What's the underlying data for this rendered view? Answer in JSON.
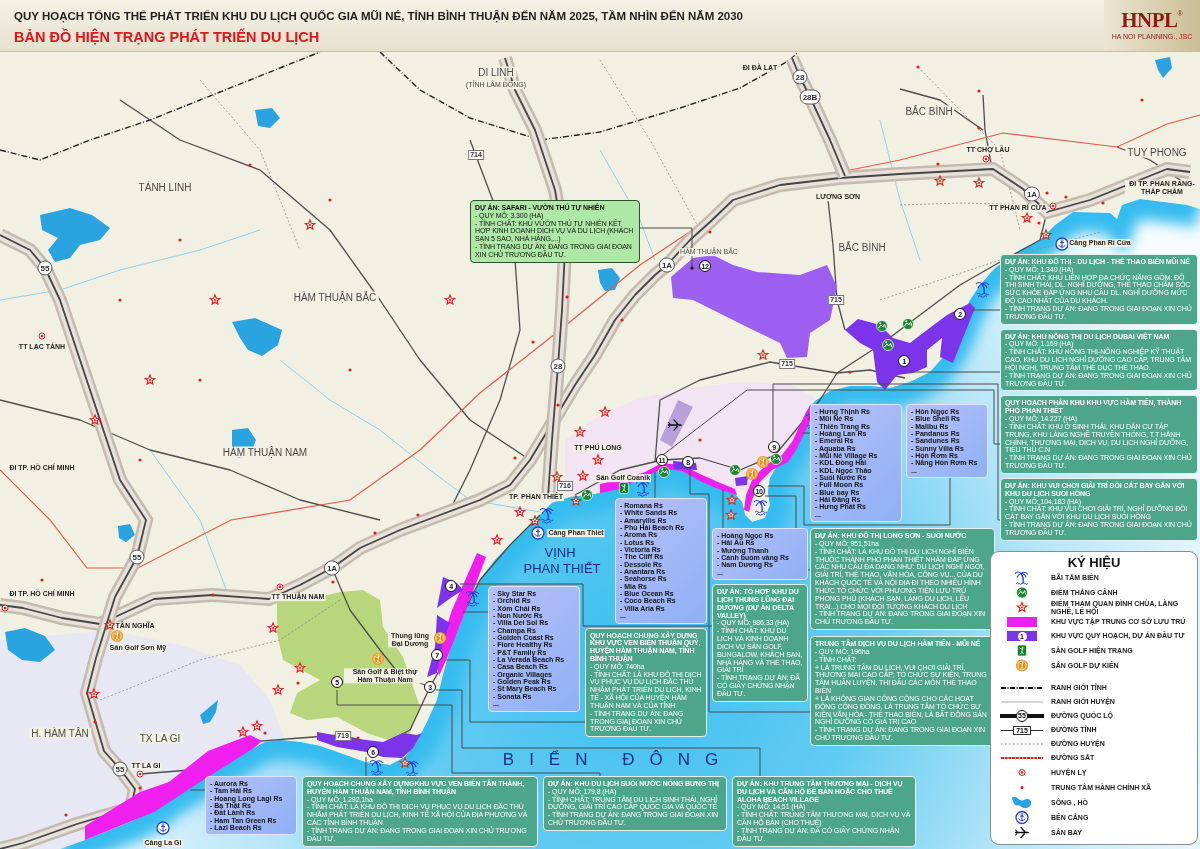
{
  "header": {
    "title": "QUY HOẠCH TỔNG THỂ PHÁT TRIỂN KHU DU LỊCH QUỐC GIA MŨI NÉ, TỈNH BÌNH THUẬN ĐẾN NĂM 2025, TẦM NHÌN ĐẾN NĂM 2030",
    "subtitle": "BẢN ĐỒ HIỆN TRẠNG PHÁT TRIỂN DU LỊCH",
    "logo": {
      "text": "HNPL",
      "mark": "®",
      "tagline": "HA NOI PLANNING., JSC"
    }
  },
  "places": [
    {
      "name": "DI LINH",
      "kind": "region"
    },
    {
      "name": "(TỈNH LÂM ĐỒNG)",
      "kind": "note"
    },
    {
      "name": "ĐI ĐÀ LẠT",
      "kind": "town"
    },
    {
      "name": "BẮC BÌNH",
      "kind": "region"
    },
    {
      "name": "TÁNH LINH",
      "kind": "region"
    },
    {
      "name": "TUY PHONG",
      "kind": "region"
    },
    {
      "name": "TT CHỢ LẦU",
      "kind": "town"
    },
    {
      "name": "LƯƠNG SƠN",
      "kind": "town"
    },
    {
      "name": "TT PHAN RÍ CỬA",
      "kind": "town"
    },
    {
      "name": "ĐI TP. PHAN RANG-THÁP CHÀM",
      "kind": "town"
    },
    {
      "name": "Cảng Phan Rí Cửa",
      "kind": "town"
    },
    {
      "name": "HÀM THUẬN BẮC",
      "kind": "region"
    },
    {
      "name": "HÀM THUẬN BẮC",
      "kind": "area"
    },
    {
      "name": "BẮC BÌNH",
      "kind": "region"
    },
    {
      "name": "TT LẠC TÁNH",
      "kind": "town"
    },
    {
      "name": "HÀM THUẬN NAM",
      "kind": "region"
    },
    {
      "name": "ĐI TP. HỒ CHÍ MINH",
      "kind": "town"
    },
    {
      "name": "TT PHÚ LONG",
      "kind": "town"
    },
    {
      "name": "TP. PHAN THIẾT",
      "kind": "town"
    },
    {
      "name": "Sân Golf Coanik",
      "kind": "town"
    },
    {
      "name": "Cảng Phan Thiết",
      "kind": "town"
    },
    {
      "name": "VỊNH",
      "kind": "sea"
    },
    {
      "name": "PHAN THIẾT",
      "kind": "sea"
    },
    {
      "name": "ĐI TP. HỒ CHÍ MINH",
      "kind": "town"
    },
    {
      "name": "TÂN NGHĨA",
      "kind": "town"
    },
    {
      "name": "Sân Golf Sơn Mỹ",
      "kind": "town"
    },
    {
      "name": "TT THUẬN NAM",
      "kind": "town"
    },
    {
      "name": "Thung lũng Đại Dương",
      "kind": "site"
    },
    {
      "name": "Sân Golf & Biệt thự Hàm Thuận Nam",
      "kind": "site"
    },
    {
      "name": "H. HÀM TÂN",
      "kind": "region"
    },
    {
      "name": "TX LA GI",
      "kind": "region"
    },
    {
      "name": "TT LA GI",
      "kind": "town"
    },
    {
      "name": "BIỂN ĐÔNG",
      "kind": "ocean"
    },
    {
      "name": "Cảng La Gi",
      "kind": "town"
    }
  ],
  "road_markers": [
    {
      "number": "1A",
      "kind": "national"
    },
    {
      "number": "1A",
      "kind": "national"
    },
    {
      "number": "1A",
      "kind": "national"
    },
    {
      "number": "55",
      "kind": "national"
    },
    {
      "number": "55",
      "kind": "national"
    },
    {
      "number": "55",
      "kind": "national"
    },
    {
      "number": "28",
      "kind": "national"
    },
    {
      "number": "28",
      "kind": "national"
    },
    {
      "number": "28B",
      "kind": "national"
    },
    {
      "number": "715",
      "kind": "provincial"
    },
    {
      "number": "715",
      "kind": "provincial"
    },
    {
      "number": "716",
      "kind": "provincial"
    },
    {
      "number": "719",
      "kind": "provincial"
    },
    {
      "number": "714",
      "kind": "provincial"
    }
  ],
  "zone_numbers": [
    "1",
    "2",
    "3",
    "4",
    "5",
    "6",
    "7",
    "8",
    "9",
    "10",
    "11",
    "12"
  ],
  "projects": [
    {
      "kind": "highlight",
      "title": "DỰ ÁN: SAFARI - VƯỜN THÚ TỰ NHIÊN",
      "lines": [
        "- QUY MÔ: 3.300 (HA)",
        "- TÍNH CHẤT: KHU VƯỜN THÚ TỰ NHIÊN KẾT HỢP KINH DOANH DỊCH VỤ VÀ DU LỊCH (KHÁCH SẠN 5 SAO, NHÀ HÀNG,...)",
        "- TÌNH TRẠNG DỰ ÁN: ĐANG TRONG GIAI ĐOẠN XIN CHỦ TRƯƠNG ĐẦU TƯ."
      ]
    },
    {
      "kind": "standard",
      "title": "DỰ ÁN: KHU ĐÔ THỊ - DU LỊCH - THỂ THAO BIỂN MŨI NÉ",
      "lines": [
        "- QUY MÔ: 1.340 (HA)",
        "- TÍNH CHẤT: KHU LIÊN HỢP ĐA CHỨC NĂNG GỒM: ĐÔ THỊ SINH THÁI, DL. NGHỈ DƯỠNG, THỂ THAO CHĂM SÓC SỨC KHỎE ĐÁP ỨNG NHU CẦU DL. NGHỈ DƯỠNG MỨC ĐỘ CAO NHẤT CỦA DU KHÁCH.",
        "- TÌNH TRẠNG DỰ ÁN: ĐANG TRONG GIAI ĐOẠN XIN CHỦ TRƯƠNG ĐẦU TƯ."
      ]
    },
    {
      "kind": "standard",
      "title": "DỰ ÁN: KHU NÔNG THỊ DU LỊCH DUBAI VIỆT NAM",
      "lines": [
        "- QUY MÔ: 1.169 (HA)",
        "- TÍNH CHẤT: KHU NÔNG THỊ-NÔNG NGHIỆP KỸ THUẬT CAO, KHU DU LỊCH NGHỈ DƯỠNG CAO CẤP, TRUNG TÂM HỘI NGHỊ, TRUNG TÂM THỂ DỤC THỂ THAO.",
        "- TÌNH TRẠNG DỰ ÁN: ĐANG TRONG GIAI ĐOẠN XIN CHỦ TRƯƠNG ĐẦU TƯ."
      ]
    },
    {
      "kind": "standard",
      "title": "QUY HOẠCH PHÂN KHU KHU VỰC HÀM TIẾN, THÀNH PHỐ PHAN THIẾT",
      "lines": [
        "- QUY MÔ: 14.227 (HA)",
        "- TÍNH CHẤT: KHU Ở SINH THÁI, KHU DÂN CƯ TẬP TRUNG, KHU LÀNG NGHỀ TRUYỀN THỐNG, T.T HÀNH CHÍNH, THƯƠNG MẠI, DỊCH VỤ, DU LỊCH NGHỈ DƯỠNG, TIỂU THỦ C.N",
        "- TÌNH TRẠNG DỰ ÁN: ĐANG TRONG GIAI ĐOẠN XIN CHỦ TRƯƠNG ĐẦU TƯ."
      ]
    },
    {
      "kind": "standard",
      "title": "DỰ ÁN: KHU VUI CHƠI GIẢI TRÍ ĐỒI CÁT BAY GẮN VỚI KHU DU LỊCH SUỐI HỒNG",
      "lines": [
        "- QUY MÔ: 104,183 (HA)",
        "- TÍNH CHẤT: KHU VUI CHƠI GIẢI TRÍ, NGHỈ DƯỠNG ĐỒI CÁT BAY GẮN VỚI KHU DU LỊCH SUỐI HỒNG",
        "- TÌNH TRẠNG DỰ ÁN: ĐANG TRONG GIAI ĐOẠN XIN CHỦ TRƯƠNG ĐẦU TƯ."
      ]
    },
    {
      "kind": "standard",
      "title": "DỰ ÁN: KHU ĐÔ THỊ LONG SƠN - SUỐI NƯỚC",
      "lines": [
        "- QUY MÔ: 951,51ha",
        "- TÍNH CHẤT: LÀ KHU ĐÔ THỊ DU LỊCH NGHỈ BIỂN THUỘC THÀNH PHỐ PHAN THIẾT NHẰM ĐÁP ỨNG CÁC NHU CẦU ĐA DẠNG NHƯ: DU LỊCH NGHỈ NGƠI, GIẢI TRÍ, THỂ THAO, VĂN HÓA, CÔNG VỤ... CỦA DU KHÁCH QUỐC TẾ VÀ NỘI ĐỊA ĐI THEO NHIỀU HÌNH THỨC TỔ CHỨC VỚI PHƯƠNG TIỆN LƯU TRÚ PHONG PHÚ (KHÁCH SẠN, LÀNG DU LỊCH, LỀU TRẠI...) CHO MỌI ĐỐI TƯỢNG KHÁCH DU LỊCH",
        "- TÌNH TRẠNG DỰ ÁN: ĐANG TRONG GIAI ĐOẠN XIN CHỦ TRƯƠNG ĐẦU TƯ."
      ]
    },
    {
      "kind": "standard",
      "title": "DỰ ÁN: TỔ HỢP KHU DU LỊCH THUNG LŨNG ĐẠI DƯƠNG (DỰ ÁN DELTA VALLEY)",
      "lines": [
        "- QUY MÔ: 986,33 (HA)",
        "- TÍNH CHẤT: KHU DU LỊCH VÀ KINH DOANH DỊCH VỤ SÂN GOLF, BUNGALOW, KHÁCH SẠN, NHÀ HÀNG VÀ THỂ THAO, GIẢI TRÍ",
        "- TÌNH TRẠNG DỰ ÁN: ĐÃ CÓ GIẤY CHỨNG NHẬN ĐẦU TƯ."
      ]
    },
    {
      "kind": "standard",
      "title": "QUY HOẠCH CHUNG XÂY DỰNG KHU VỰC VEN BIỂN THUẬN QUÝ, HUYỆN HÀM THUẬN NAM, TỈNH BÌNH THUẬN",
      "lines": [
        "- QUY MÔ: 740ha",
        "- TÍNH CHẤT: LÀ KHU ĐÔ THỊ DỊCH VỤ PHỤC VỤ DU LỊCH ĐẶC THÙ NHẰM PHÁT TRIỂN DU LỊCH, KINH TẾ - XÃ HỘI CỦA HUYỆN HÀM THUẬN NAM VÀ CỦA TỈNH",
        "- TÌNH TRẠNG DỰ ÁN: ĐANG TRONG GIAI ĐOẠN XIN CHỦ TRƯƠNG ĐẦU TƯ."
      ]
    },
    {
      "kind": "standard",
      "title": "TRUNG TÂM DỊCH VỤ DU LỊCH HÀM TIẾN - MŨI NÉ",
      "lines": [
        "- QUY MÔ: 196ha",
        "- TÍNH CHẤT:",
        "+ LÀ TRUNG TÂM DU LỊCH, VUI CHƠI GIẢI TRÍ, THƯƠNG MẠI CAO CẤP; TỔ CHỨC SỰ KIỆN, TRUNG TÂM HUẤN LUYỆN, THI ĐẤU CÁC MÔN THỂ THAO BIỂN",
        "+ LÀ KHÔNG GIAN CÔNG CỘNG CHO CÁC HOẠT ĐỘNG CỘNG ĐỒNG, LÀ TRUNG TÂM TỔ CHỨC SỰ KIỆN VĂN HÓA - THỂ THAO BIỂN, LÀ BẤT ĐỘNG SẢN NGHỈ DƯỠNG CÓ GIÁ TRỊ CAO",
        "- TÌNH TRẠNG DỰ ÁN: ĐANG TRONG GIAI ĐOẠN XIN CHỦ TRƯƠNG ĐẦU TƯ."
      ]
    },
    {
      "kind": "standard",
      "title": "QUY HOẠCH CHUNG XÂY DỰNGKHU VỰC VEN BIỂN TÂN THÀNH, HUYỆN HÀM THUẬN NAM, TỈNH BÌNH THUẬN",
      "lines": [
        "- QUY MÔ: 1.292,1ha",
        "- TÍNH CHẤT: LÀ KHU ĐÔ THỊ DỊCH VỤ PHỤC VỤ DU LỊCH ĐẶC THÙ NHẰM PHÁT TRIỂN DU LỊCH, KINH TẾ XÃ HỘI CỦA ĐỊA PHƯƠNG VÀ CÁC TỈNH BÌNH THUẬN",
        "- TÌNH TRẠNG DỰ ÁN: ĐANG TRONG GIAI ĐOẠN XIN CHỦ TRƯƠNG ĐẦU TƯ."
      ]
    },
    {
      "kind": "standard",
      "title": "DỰ ÁN: KHU DU LỊCH SUỐI NƯỚC NÓNG BƯNG THỊ",
      "lines": [
        "- QUY MÔ: 179,8 (HA)",
        "- TÍNH CHẤT: TRUNG TÂM DU LỊCH SINH THÁI, NGHỈ DƯỠNG, GIẢI TRÍ CAO CẤP QUỐC GIA VÀ QUỐC TẾ",
        "- TÌNH TRẠNG DỰ ÁN: ĐANG TRONG GIAI ĐOẠN XIN CHỦ TRƯƠNG ĐẦU TƯ."
      ]
    },
    {
      "kind": "standard",
      "title": "DỰ ÁN: KHU TRUNG TÂM THƯƠNG MẠI - DỊCH VỤ DU LỊCH VÀ CĂN HỘ ĐỂ BÁN HOẶC CHO THUÊ ALOHA BEACH VILLAGE",
      "lines": [
        "- QUY MÔ: 14,51 (HA)",
        "- TÍNH CHẤT: TRUNG TÂM THƯƠNG MẠI, DỊCH VỤ VÀ CĂN HỘ BÁN (CHO THUÊ)",
        "- TÌNH TRẠNG DỰ ÁN: ĐÃ CÓ GIẤY CHỨNG NHẬN ĐẦU TƯ."
      ]
    }
  ],
  "resort_lists": [
    {
      "items": [
        "- Hưng Thịnh Rs",
        "- Mũi Né Rs",
        "- Thiên Trang Rs",
        "- Hoàng Lan Rs",
        "- Emeral Rs",
        "- Aquaba Rs",
        "- Mũi Né Village Rs",
        "- KDL Đồng Hải",
        "- KDL Ngọc Thảo",
        "- Suối Nước Rs",
        "- Full Moon Rs",
        "- Blue bay Rs",
        "- Hải Đăng Rs",
        "- Hưng Phát Rs",
        "..."
      ]
    },
    {
      "items": [
        "- Hòn Ngọc Rs",
        "- Blue Shell Rs",
        "- Malibu Rs",
        "- Pandanus Rs",
        "- Sandunes Rs",
        "- Sunny Villa Rs",
        "- Hòn Rơm Rs",
        "- Nắng Hòn Rơm Rs",
        "..."
      ]
    },
    {
      "items": [
        "- Romana Rs",
        "- White Sands Rs",
        "- Amaryllis Rs",
        "- Phú Hải Beach Rs",
        "- Aroma Rs",
        "- Lotus Rs",
        "- Victoria Rs",
        "- The Cliff Rs",
        "- Dessole Rs",
        "- Anantara Rs",
        "- Seahorse Rs",
        "- Mia Rs",
        "- Blue Ocean Rs",
        "- Coco Beach Rs",
        "- Villa Aria Rs",
        "..."
      ]
    },
    {
      "items": [
        "- Hoàng Ngọc Rs",
        "- Hải Âu Rs",
        "- Mường Thanh",
        "- Cánh buồm vàng Rs",
        "- Nam Dương Rs",
        "..."
      ]
    },
    {
      "items": [
        "- Sky Star Rs",
        "- Orchid Rs",
        "- Xóm Chài Rs",
        "- Non Nước Rs",
        "- Villa Del Sol Rs",
        "- Champa Rs",
        "- Golden Coast Rs",
        "- Fiore Healthy Rs",
        "- P&T Family Rs",
        "- La Verada Beach Rs",
        "- Casa Beach Rs",
        "- Organic Villages",
        "- Golden Peak Rs",
        "- St Mary Beach Rs",
        "- Sonata Rs",
        "..."
      ]
    },
    {
      "items": [
        "- Aurora Rs",
        "- Tam Hải Rs",
        "- Hoang Long Lagi Rs",
        "- Bạ Thật Rs",
        "- Đất Lành Rs",
        "- Ham Tan Green Rs",
        "- Lazi Beach Rs"
      ]
    }
  ],
  "legend": {
    "title": "KÝ HIỆU",
    "items": [
      {
        "label": "BÃI TẮM BIỂN",
        "kind": "beach"
      },
      {
        "label": "ĐIỂM THẮNG CẢNH",
        "kind": "scenic"
      },
      {
        "label": "ĐIỂM THAM QUAN ĐÌNH CHÙA, LÀNG NGHỀ, LỄ HỘI",
        "kind": "temple"
      },
      {
        "label": "KHU VỰC TẬP TRUNG CƠ SỞ LƯU TRÚ",
        "kind": "lodging"
      },
      {
        "label": "KHU VỰC QUY HOẠCH, DỰ ÁN ĐẦU TƯ",
        "kind": "project",
        "symbol": "1"
      },
      {
        "label": "SÂN GOLF HIỆN TRẠNG",
        "kind": "golf"
      },
      {
        "label": "SÂN GOLF DỰ KIẾN",
        "kind": "golf_planned"
      },
      {
        "label": "RANH GIỚI TỈNH",
        "kind": "province_border"
      },
      {
        "label": "RANH GIỚI HUYỆN",
        "kind": "district_border"
      },
      {
        "label": "ĐƯỜNG QUỐC LỘ",
        "kind": "national_road",
        "symbol": "55"
      },
      {
        "label": "ĐƯỜNG TỈNH",
        "kind": "provincial_road",
        "symbol": "715"
      },
      {
        "label": "ĐƯỜNG HUYỆN",
        "kind": "district_road"
      },
      {
        "label": "ĐƯỜNG SẮT",
        "kind": "railway"
      },
      {
        "label": "HUYỆN LỴ",
        "kind": "district_town"
      },
      {
        "label": "TRUNG TÂM HÀNH CHÍNH XÃ",
        "kind": "commune_center"
      },
      {
        "label": "SÔNG , HỒ",
        "kind": "water"
      },
      {
        "label": "BẾN CẢNG",
        "kind": "port"
      },
      {
        "label": "SÂN BAY",
        "kind": "airport"
      }
    ]
  }
}
